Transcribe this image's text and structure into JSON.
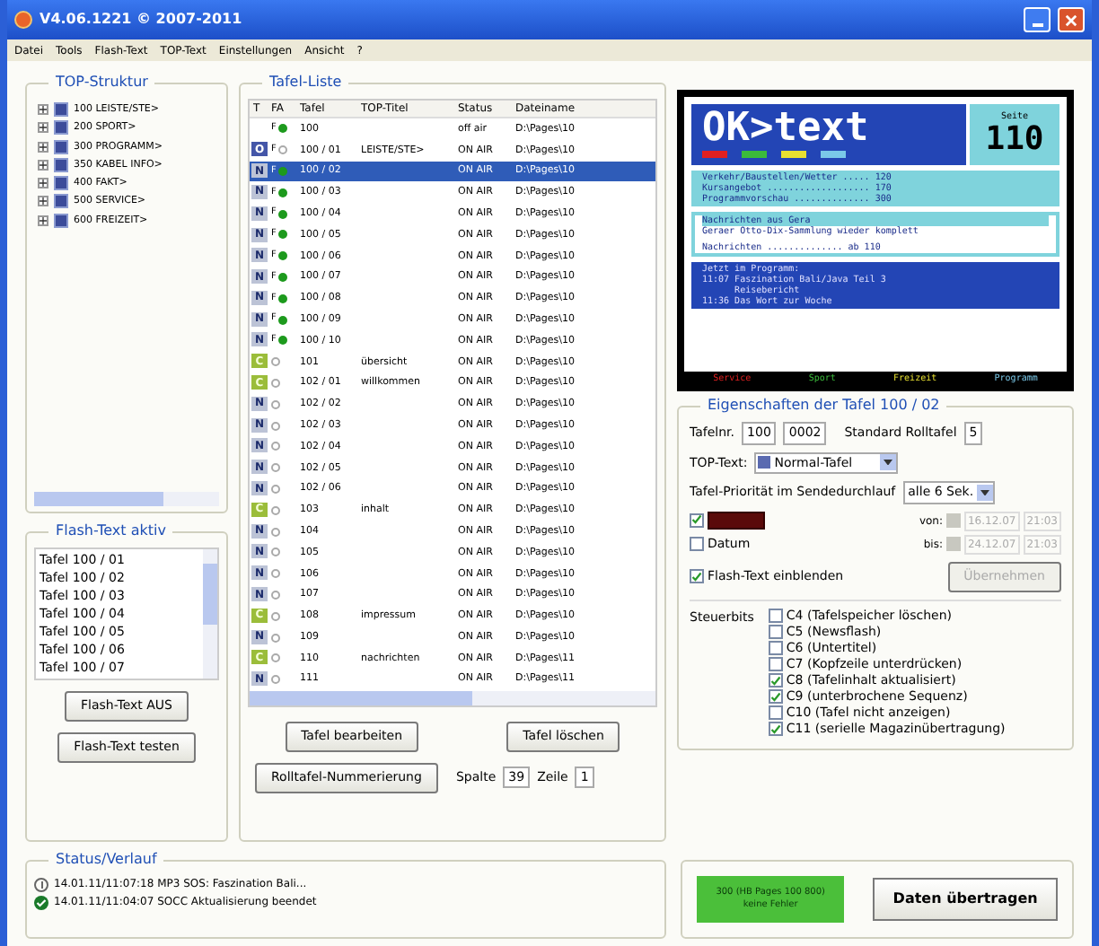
{
  "window": {
    "title": "V4.06.1221 © 2007-2011"
  },
  "menu": [
    "Datei",
    "Tools",
    "Flash-Text",
    "TOP-Text",
    "Einstellungen",
    "Ansicht",
    "?"
  ],
  "top_structure": {
    "title": "TOP-Struktur",
    "items": [
      {
        "label": "100 LEISTE/STE>",
        "expanded": false
      },
      {
        "label": "200 SPORT>",
        "expanded": false
      },
      {
        "label": "300 PROGRAMM>",
        "expanded": false
      },
      {
        "label": "350 KABEL INFO>",
        "expanded": false
      },
      {
        "label": "400 FAKT>",
        "expanded": false
      },
      {
        "label": "500 SERVICE>",
        "expanded": false
      },
      {
        "label": "600 FREIZEIT>",
        "expanded": false
      }
    ]
  },
  "flash_text": {
    "title": "Flash-Text aktiv",
    "items": [
      "Tafel 100 / 01",
      "Tafel 100 / 02",
      "Tafel 100 / 03",
      "Tafel 100 / 04",
      "Tafel 100 / 05",
      "Tafel 100 / 06",
      "Tafel 100 / 07"
    ],
    "buttons": [
      "Flash-Text AUS",
      "Flash-Text testen"
    ]
  },
  "table": {
    "title": "Tafel-Liste",
    "columns": [
      "T",
      "FA",
      "Tafel",
      "TOP-Titel",
      "Status",
      "Dateiname"
    ],
    "rows": [
      {
        "fa": "F",
        "fa_on": true,
        "tafel": "100",
        "title": "",
        "status": "off air",
        "file": "D:\\Pages\\10",
        "selected": false
      },
      {
        "type": "O",
        "fa": "F",
        "fa_on": false,
        "tafel": "100 / 01",
        "title": "LEISTE/STE>",
        "status": "ON AIR",
        "file": "D:\\Pages\\10",
        "selected": false
      },
      {
        "type": "N",
        "fa": "F",
        "fa_on": true,
        "tafel": "100 / 02",
        "title": "",
        "status": "ON AIR",
        "file": "D:\\Pages\\10",
        "selected": true
      },
      {
        "type": "N",
        "fa": "F",
        "fa_on": true,
        "tafel": "100 / 03",
        "title": "",
        "status": "ON AIR",
        "file": "D:\\Pages\\10",
        "selected": false
      },
      {
        "type": "N",
        "fa": "F",
        "fa_on": true,
        "tafel": "100 / 04",
        "title": "",
        "status": "ON AIR",
        "file": "D:\\Pages\\10",
        "selected": false
      },
      {
        "type": "N",
        "fa": "F",
        "fa_on": true,
        "tafel": "100 / 05",
        "title": "",
        "status": "ON AIR",
        "file": "D:\\Pages\\10",
        "selected": false
      },
      {
        "type": "N",
        "fa": "F",
        "fa_on": true,
        "tafel": "100 / 06",
        "title": "",
        "status": "ON AIR",
        "file": "D:\\Pages\\10",
        "selected": false
      },
      {
        "type": "N",
        "fa": "F",
        "fa_on": true,
        "tafel": "100 / 07",
        "title": "",
        "status": "ON AIR",
        "file": "D:\\Pages\\10",
        "selected": false
      },
      {
        "type": "N",
        "fa": "F",
        "fa_on": true,
        "tafel": "100 / 08",
        "title": "",
        "status": "ON AIR",
        "file": "D:\\Pages\\10",
        "selected": false
      },
      {
        "type": "N",
        "fa": "F",
        "fa_on": true,
        "tafel": "100 / 09",
        "title": "",
        "status": "ON AIR",
        "file": "D:\\Pages\\10",
        "selected": false
      },
      {
        "type": "N",
        "fa": "F",
        "fa_on": true,
        "tafel": "100 / 10",
        "title": "",
        "status": "ON AIR",
        "file": "D:\\Pages\\10",
        "selected": false
      },
      {
        "type": "C",
        "fa_on": false,
        "tafel": "101",
        "title": "übersicht",
        "status": "ON AIR",
        "file": "D:\\Pages\\10",
        "selected": false
      },
      {
        "type": "C",
        "fa_on": false,
        "tafel": "102 / 01",
        "title": "willkommen",
        "status": "ON AIR",
        "file": "D:\\Pages\\10",
        "selected": false
      },
      {
        "type": "N",
        "fa_on": false,
        "tafel": "102 / 02",
        "title": "",
        "status": "ON AIR",
        "file": "D:\\Pages\\10",
        "selected": false
      },
      {
        "type": "N",
        "fa_on": false,
        "tafel": "102 / 03",
        "title": "",
        "status": "ON AIR",
        "file": "D:\\Pages\\10",
        "selected": false
      },
      {
        "type": "N",
        "fa_on": false,
        "tafel": "102 / 04",
        "title": "",
        "status": "ON AIR",
        "file": "D:\\Pages\\10",
        "selected": false
      },
      {
        "type": "N",
        "fa_on": false,
        "tafel": "102 / 05",
        "title": "",
        "status": "ON AIR",
        "file": "D:\\Pages\\10",
        "selected": false
      },
      {
        "type": "N",
        "fa_on": false,
        "tafel": "102 / 06",
        "title": "",
        "status": "ON AIR",
        "file": "D:\\Pages\\10",
        "selected": false
      },
      {
        "type": "C",
        "fa_on": false,
        "tafel": "103",
        "title": "inhalt",
        "status": "ON AIR",
        "file": "D:\\Pages\\10",
        "selected": false
      },
      {
        "type": "N",
        "fa_on": false,
        "tafel": "104",
        "title": "",
        "status": "ON AIR",
        "file": "D:\\Pages\\10",
        "selected": false
      },
      {
        "type": "N",
        "fa_on": false,
        "tafel": "105",
        "title": "",
        "status": "ON AIR",
        "file": "D:\\Pages\\10",
        "selected": false
      },
      {
        "type": "N",
        "fa_on": false,
        "tafel": "106",
        "title": "",
        "status": "ON AIR",
        "file": "D:\\Pages\\10",
        "selected": false
      },
      {
        "type": "N",
        "fa_on": false,
        "tafel": "107",
        "title": "",
        "status": "ON AIR",
        "file": "D:\\Pages\\10",
        "selected": false
      },
      {
        "type": "C",
        "fa_on": false,
        "tafel": "108",
        "title": "impressum",
        "status": "ON AIR",
        "file": "D:\\Pages\\10",
        "selected": false
      },
      {
        "type": "N",
        "fa_on": false,
        "tafel": "109",
        "title": "",
        "status": "ON AIR",
        "file": "D:\\Pages\\10",
        "selected": false
      },
      {
        "type": "C",
        "fa_on": false,
        "tafel": "110",
        "title": "nachrichten",
        "status": "ON AIR",
        "file": "D:\\Pages\\11",
        "selected": false
      },
      {
        "type": "N",
        "fa_on": false,
        "tafel": "111",
        "title": "",
        "status": "ON AIR",
        "file": "D:\\Pages\\11",
        "selected": false
      }
    ],
    "buttons": [
      "Tafel bearbeiten",
      "Tafel löschen",
      "Rolltafel-Nummerierung"
    ],
    "column_label": "Spalte",
    "column_value": "39",
    "line_label": "Zeile",
    "line_value": "1"
  },
  "preview": {
    "logo": "OK>text",
    "page_label": "Seite",
    "page": "110",
    "index_lines": [
      "Verkehr/Baustellen/Wetter ..... 120",
      "Kursangebot ................... 170",
      "Programmvorschau .............. 300"
    ],
    "news_title": "Nachrichten aus Gera",
    "news_text": "Geraer Otto-Dix-Sammlung wieder komplett",
    "news_link": "Nachrichten .............. ab 110",
    "program_lines": [
      "Jetzt im Programm:",
      "11:07 Faszination Bali/Java Teil 3",
      "      Reisebericht",
      "11:36 Das Wort zur Woche"
    ],
    "footer": [
      "Service",
      "Sport",
      "Freizeit",
      "Programm"
    ]
  },
  "properties": {
    "title": "Eigenschaften der Tafel 100 / 02",
    "number_label": "Tafelnr.",
    "number": "100",
    "sub": "0002",
    "roll_label": "Standard Rolltafel",
    "roll": "5",
    "top_label": "TOP-Text:",
    "top_value": "Normal-Tafel",
    "priority_label": "Tafel-Priorität im Sendedurchlauf",
    "priority_value": "alle 6 Sek.",
    "time_checked": true,
    "date_label": "Datum",
    "date_checked": false,
    "from_label": "von:",
    "from_date": "16.12.07",
    "from_time": "21:03",
    "to_label": "bis:",
    "to_date": "24.12.07",
    "to_time": "21:03",
    "flash_label": "Flash-Text einblenden",
    "flash_checked": true,
    "apply_button": "Übernehmen",
    "bits_label": "Steuerbits",
    "bits": [
      {
        "label": "C4 (Tafelspeicher löschen)",
        "checked": false
      },
      {
        "label": "C5 (Newsflash)",
        "checked": false
      },
      {
        "label": "C6 (Untertitel)",
        "checked": false
      },
      {
        "label": "C7 (Kopfzeile unterdrücken)",
        "checked": false
      },
      {
        "label": "C8 (Tafelinhalt aktualisiert)",
        "checked": true
      },
      {
        "label": "C9 (unterbrochene Sequenz)",
        "checked": true
      },
      {
        "label": "C10 (Tafel nicht anzeigen)",
        "checked": false
      },
      {
        "label": "C11 (serielle Magazinübertragung)",
        "checked": true
      }
    ]
  },
  "status": {
    "title": "Status/Verlauf",
    "entries": [
      {
        "kind": "info",
        "text": "14.01.11/11:07:18 MP3 SOS: Faszination Bali..."
      },
      {
        "kind": "ok",
        "text": "14.01.11/11:04:07 SOCC Aktualisierung beendet"
      }
    ]
  },
  "result": {
    "text": "300 (HB Pages 100 800) keine Fehler"
  },
  "transfer_button": "Daten übertragen"
}
